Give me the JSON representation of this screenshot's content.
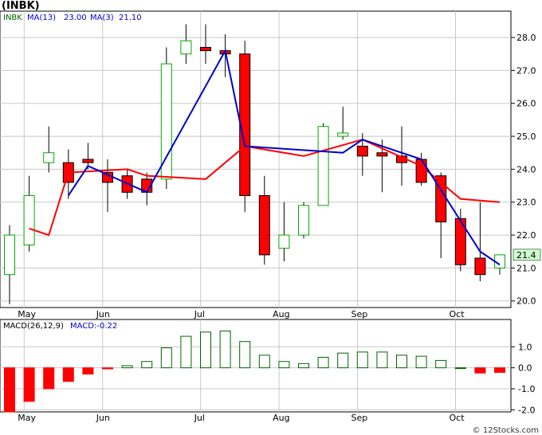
{
  "title": "(INBK)",
  "copyright": "© 12Stocks.com",
  "chart_data": [
    {
      "type": "candlestick",
      "ticker": "INBK",
      "legend": {
        "ticker": "INBK",
        "ma13_label": "MA(13)",
        "ma13_value": "23.00",
        "ma3_label": "MA(3)",
        "ma3_value": "21.10"
      },
      "last_price_label": "21.4",
      "ylim": [
        19.8,
        28.8
      ],
      "yticks": [
        "20.0",
        "21.0",
        "22.0",
        "23.0",
        "24.0",
        "25.0",
        "26.0",
        "27.0",
        "28.0"
      ],
      "x_tick_labels": [
        "May",
        "Jun",
        "Jul",
        "Aug",
        "Sep",
        "Oct"
      ],
      "x_tick_index": [
        1,
        5,
        10,
        14,
        18,
        23
      ],
      "grid": true,
      "colors": {
        "up": "#ffffff",
        "up_stroke": "#00aa00",
        "down": "#ff0000",
        "wick": "#000000",
        "ma13": "#ff0000",
        "ma3": "#0000cc",
        "price_box": "#ccffcc"
      },
      "candles": [
        {
          "o": 20.8,
          "h": 22.3,
          "l": 19.9,
          "c": 22.0
        },
        {
          "o": 21.7,
          "h": 23.8,
          "l": 21.5,
          "c": 23.2
        },
        {
          "o": 24.2,
          "h": 25.3,
          "l": 23.9,
          "c": 24.5
        },
        {
          "o": 24.2,
          "h": 24.6,
          "l": 23.1,
          "c": 23.6
        },
        {
          "o": 24.3,
          "h": 24.8,
          "l": 24.0,
          "c": 24.2
        },
        {
          "o": 23.9,
          "h": 24.3,
          "l": 22.7,
          "c": 23.6
        },
        {
          "o": 23.8,
          "h": 24.0,
          "l": 23.1,
          "c": 23.3
        },
        {
          "o": 23.7,
          "h": 23.9,
          "l": 22.9,
          "c": 23.3
        },
        {
          "o": 23.7,
          "h": 27.7,
          "l": 23.4,
          "c": 27.2
        },
        {
          "o": 27.5,
          "h": 28.4,
          "l": 27.2,
          "c": 27.9
        },
        {
          "o": 27.7,
          "h": 28.4,
          "l": 27.2,
          "c": 27.6
        },
        {
          "o": 27.6,
          "h": 28.1,
          "l": 26.8,
          "c": 27.5
        },
        {
          "o": 27.5,
          "h": 27.9,
          "l": 22.7,
          "c": 23.2
        },
        {
          "o": 23.2,
          "h": 23.8,
          "l": 21.1,
          "c": 21.4
        },
        {
          "o": 21.6,
          "h": 23.0,
          "l": 21.2,
          "c": 22.0
        },
        {
          "o": 22.0,
          "h": 23.0,
          "l": 21.9,
          "c": 22.9
        },
        {
          "o": 22.9,
          "h": 25.4,
          "l": 22.9,
          "c": 25.3
        },
        {
          "o": 25.0,
          "h": 25.9,
          "l": 24.9,
          "c": 25.1
        },
        {
          "o": 24.7,
          "h": 25.1,
          "l": 23.8,
          "c": 24.4
        },
        {
          "o": 24.5,
          "h": 24.9,
          "l": 23.3,
          "c": 24.4
        },
        {
          "o": 24.4,
          "h": 25.3,
          "l": 23.5,
          "c": 24.2
        },
        {
          "o": 24.3,
          "h": 24.5,
          "l": 23.5,
          "c": 23.6
        },
        {
          "o": 23.8,
          "h": 23.9,
          "l": 21.3,
          "c": 22.4
        },
        {
          "o": 22.5,
          "h": 22.8,
          "l": 20.9,
          "c": 21.1
        },
        {
          "o": 21.3,
          "h": 23.0,
          "l": 20.6,
          "c": 20.8
        },
        {
          "o": 21.0,
          "h": 21.4,
          "l": 20.8,
          "c": 21.4
        }
      ],
      "ma13": [
        null,
        22.2,
        22.0,
        23.9,
        null,
        null,
        24.0,
        23.8,
        null,
        null,
        23.7,
        null,
        24.7,
        null,
        null,
        24.4,
        null,
        null,
        24.9,
        null,
        null,
        24.1,
        null,
        23.1,
        null,
        23.0
      ],
      "ma3": [
        null,
        null,
        null,
        23.2,
        24.1,
        null,
        null,
        23.3,
        null,
        null,
        null,
        27.6,
        24.7,
        null,
        null,
        null,
        null,
        24.5,
        24.9,
        null,
        null,
        24.3,
        null,
        null,
        21.5,
        21.1
      ]
    },
    {
      "type": "bar",
      "name": "MACD",
      "legend": {
        "label": "MACD(26,12,9)",
        "value_label": "MACD:-0.22"
      },
      "ylim": [
        -2.1,
        2.3
      ],
      "yticks": [
        "1.0",
        "0.0",
        "-1.0",
        "-2.0"
      ],
      "x_tick_labels": [
        "May",
        "Jun",
        "Jul",
        "Aug",
        "Sep",
        "Oct"
      ],
      "colors": {
        "positive_stroke": "#006600",
        "negative_fill": "#ff0000"
      },
      "values": [
        -2.1,
        -1.6,
        -1.0,
        -0.65,
        -0.3,
        -0.05,
        0.1,
        0.3,
        0.95,
        1.5,
        1.7,
        1.75,
        1.25,
        0.6,
        0.3,
        0.2,
        0.5,
        0.7,
        0.75,
        0.75,
        0.6,
        0.55,
        0.35,
        0.0,
        -0.25,
        -0.22
      ]
    }
  ]
}
